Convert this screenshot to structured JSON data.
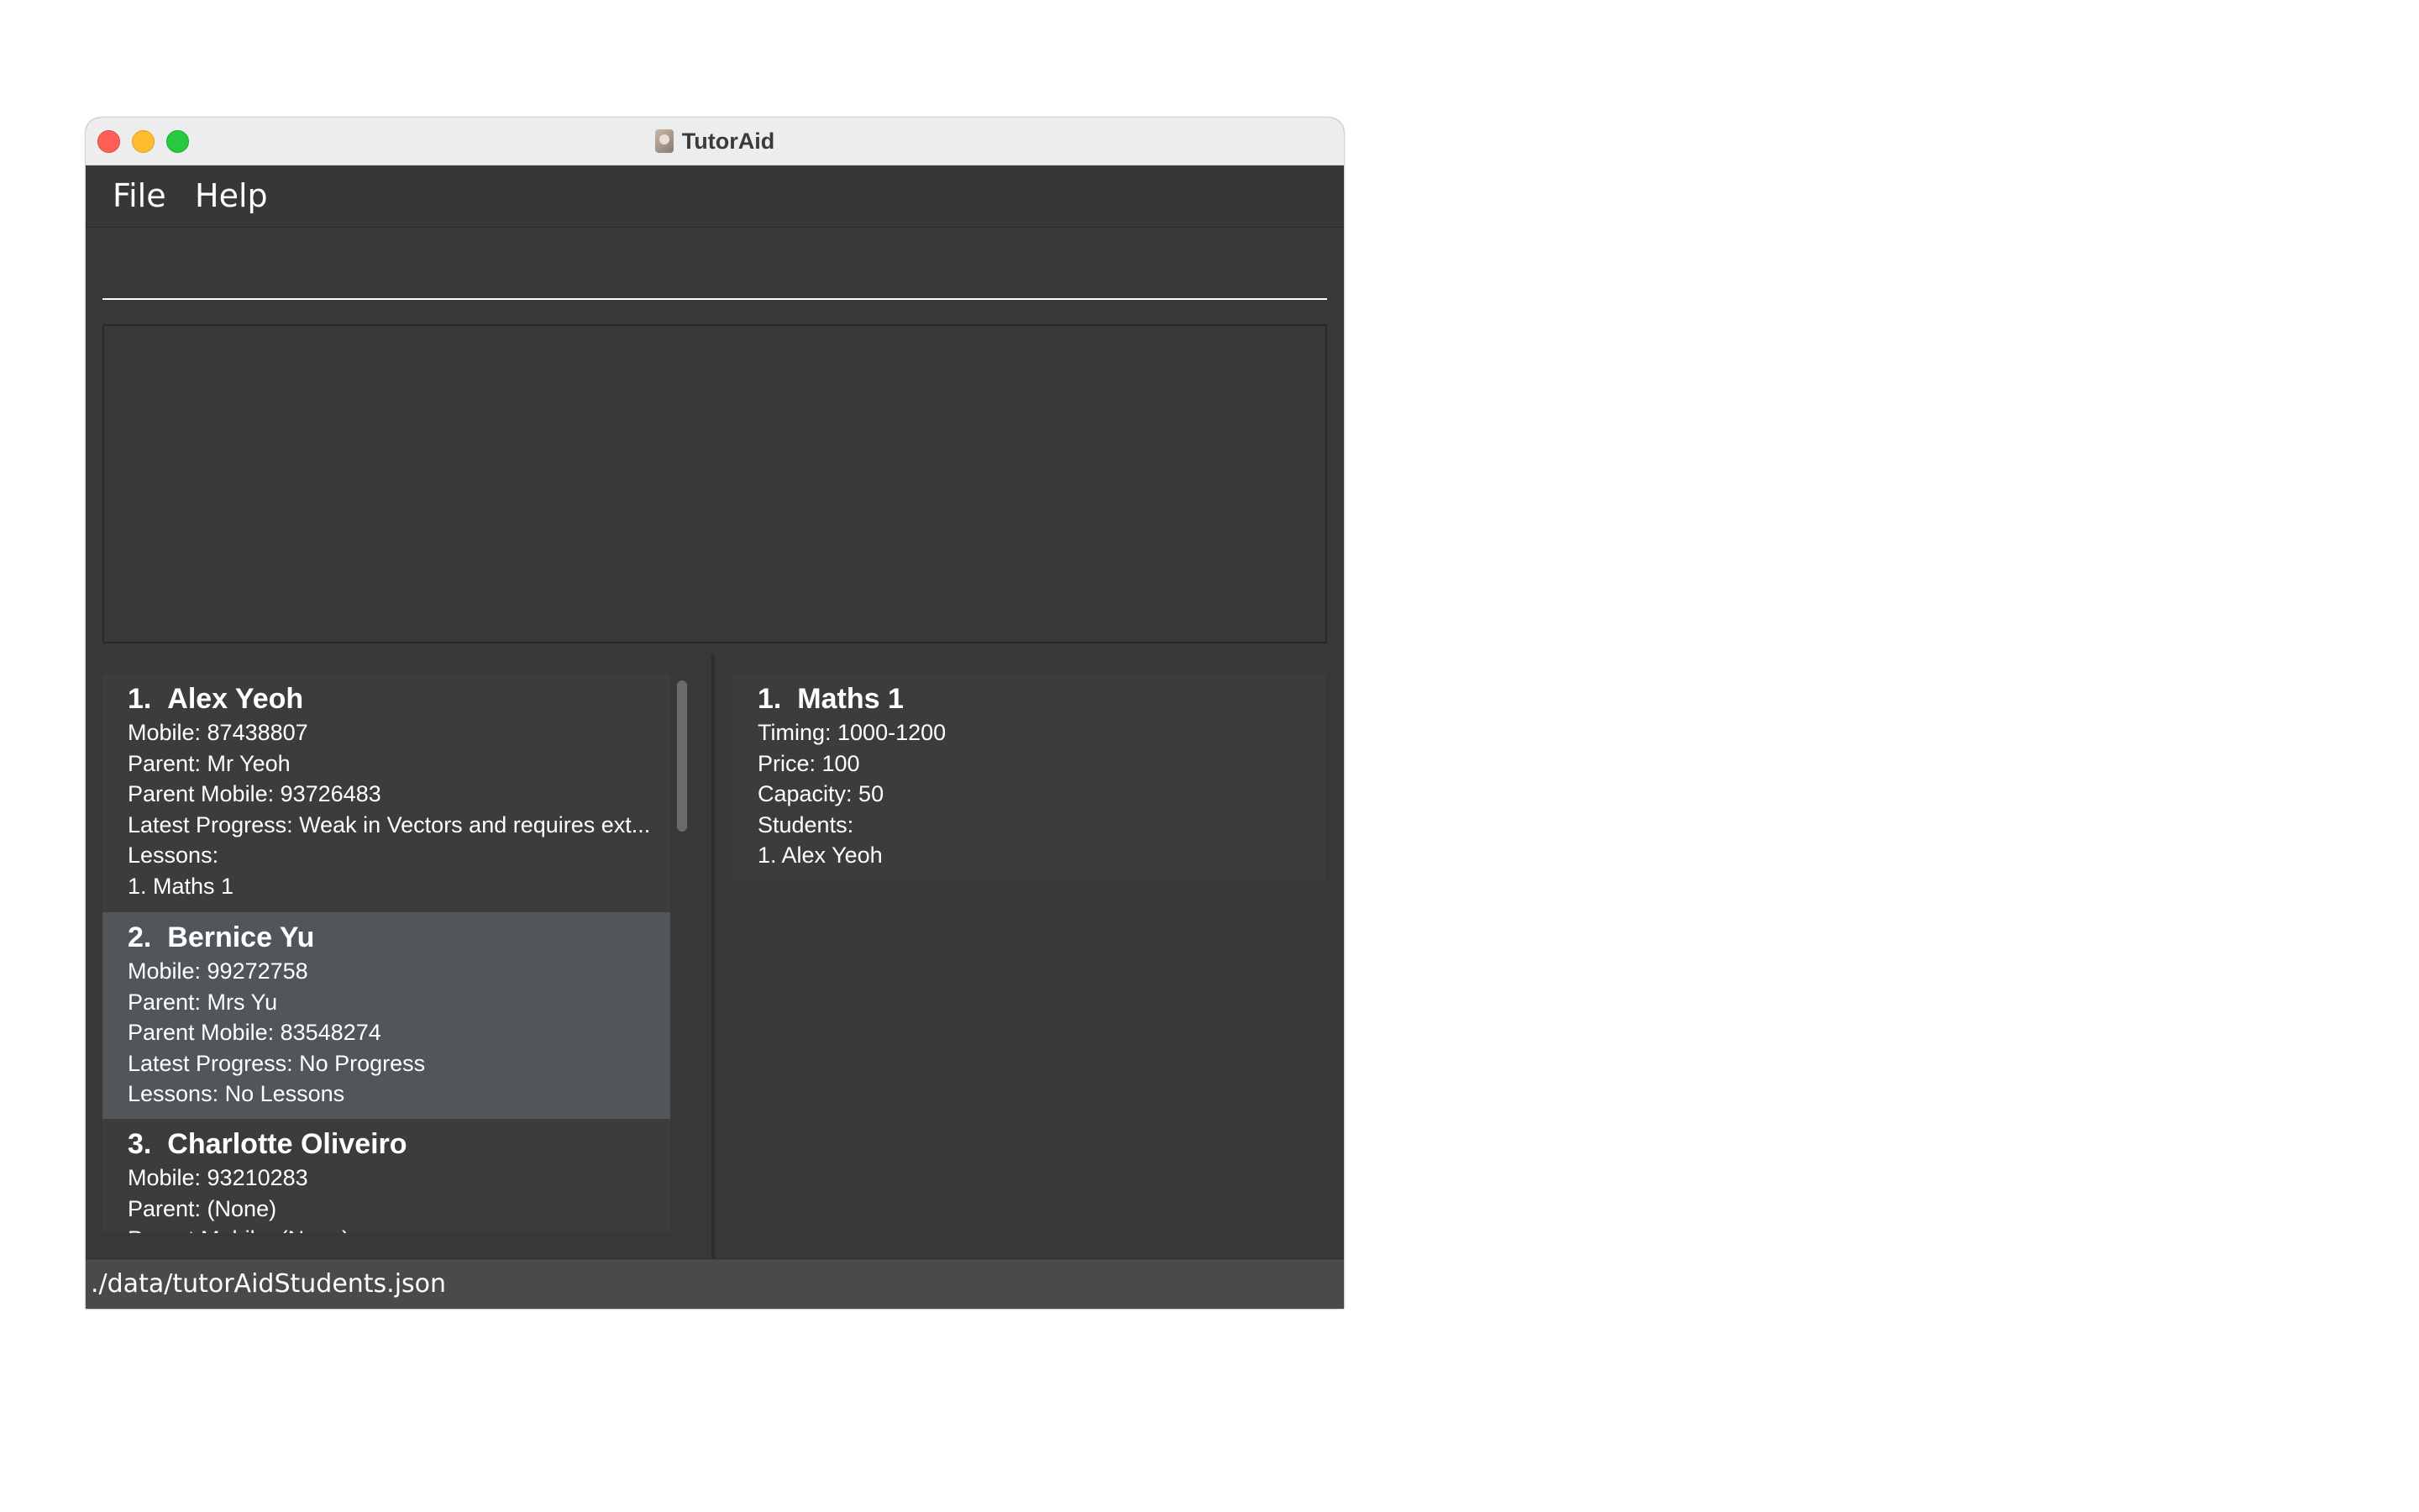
{
  "window": {
    "title": "TutorAid"
  },
  "menu": {
    "file": "File",
    "help": "Help"
  },
  "command": {
    "value": ""
  },
  "result": {
    "text": ""
  },
  "students": [
    {
      "index": "1.",
      "name": "Alex Yeoh",
      "lines": [
        "Mobile: 87438807",
        "Parent: Mr Yeoh",
        "Parent Mobile: 93726483",
        "Latest Progress: Weak in Vectors and requires ext...",
        "Lessons:",
        "1.  Maths 1"
      ]
    },
    {
      "index": "2.",
      "name": "Bernice Yu",
      "lines": [
        "Mobile: 99272758",
        "Parent: Mrs Yu",
        "Parent Mobile: 83548274",
        "Latest Progress: No Progress",
        "Lessons: No Lessons"
      ]
    },
    {
      "index": "3.",
      "name": "Charlotte Oliveiro",
      "lines": [
        "Mobile: 93210283",
        "Parent: (None)",
        "Parent Mobile: (None)"
      ]
    }
  ],
  "lessons": [
    {
      "index": "1.",
      "name": "Maths 1",
      "lines": [
        "Timing: 1000-1200",
        "Price: 100",
        "Capacity: 50",
        "Students:",
        "1.  Alex Yeoh"
      ]
    }
  ],
  "status": {
    "path": "./data/tutorAidStudents.json"
  },
  "colors": {
    "window_bg": "#383838",
    "selected_card": "#505659",
    "card_bg": "#3c3c3c",
    "status_bg": "#4a4a4a"
  }
}
